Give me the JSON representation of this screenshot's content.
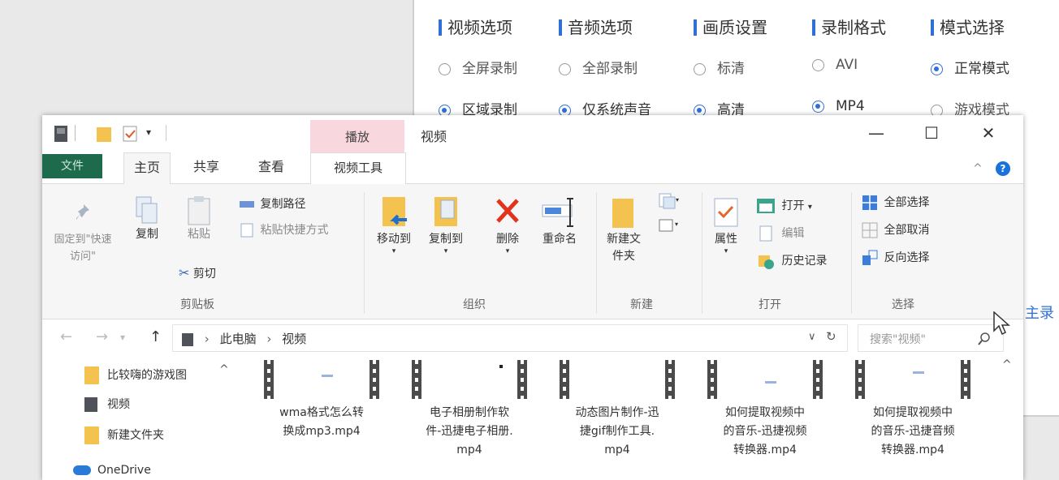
{
  "recorder": {
    "columns": [
      {
        "title": "视频选项",
        "options": [
          {
            "label": "全屏录制",
            "checked": false
          },
          {
            "label": "区域录制",
            "checked": true
          }
        ]
      },
      {
        "title": "音频选项",
        "options": [
          {
            "label": "全部录制",
            "checked": false
          },
          {
            "label": "仅系统声音",
            "checked": true
          }
        ]
      },
      {
        "title": "画质设置",
        "options": [
          {
            "label": "标清",
            "checked": false
          },
          {
            "label": "高清",
            "checked": true
          }
        ]
      },
      {
        "title": "录制格式",
        "options": [
          {
            "label": "AVI",
            "checked": false
          },
          {
            "label": "MP4",
            "checked": true
          }
        ]
      },
      {
        "title": "模式选择",
        "options": [
          {
            "label": "正常模式",
            "checked": true
          },
          {
            "label": "游戏模式",
            "checked": false
          }
        ]
      }
    ],
    "partial_link": "主录"
  },
  "explorer": {
    "context_tab": "播放",
    "title": "视频",
    "window_buttons": {
      "minimize": "—",
      "maximize": "☐",
      "close": "✕"
    },
    "tabs": {
      "file": "文件",
      "home": "主页",
      "share": "共享",
      "view": "查看",
      "video_tools": "视频工具"
    },
    "ribbon": {
      "clipboard": {
        "pin": "固定到\"快速访问\"",
        "copy": "复制",
        "paste": "粘贴",
        "copy_path": "复制路径",
        "paste_shortcut": "粘贴快捷方式",
        "cut": "剪切",
        "group": "剪贴板"
      },
      "organize": {
        "move_to": "移动到",
        "copy_to": "复制到",
        "delete": "删除",
        "rename": "重命名",
        "group": "组织"
      },
      "new": {
        "new_folder": "新建文件夹",
        "group": "新建"
      },
      "open": {
        "properties": "属性",
        "open": "打开",
        "edit": "编辑",
        "history": "历史记录",
        "group": "打开"
      },
      "select": {
        "select_all": "全部选择",
        "select_none": "全部取消",
        "invert": "反向选择",
        "group": "选择"
      }
    },
    "address": {
      "crumbs": [
        "此电脑",
        "视频"
      ],
      "search_placeholder": "搜索\"视频\""
    },
    "nav_items": [
      "比较嗨的游戏图",
      "视频",
      "新建文件夹",
      "OneDrive"
    ],
    "files": [
      {
        "line1": "wma格式怎么转",
        "line2": "换成mp3.mp4",
        "line3": ""
      },
      {
        "line1": "电子相册制作软",
        "line2": "件-迅捷电子相册.",
        "line3": "mp4"
      },
      {
        "line1": "动态图片制作-迅",
        "line2": "捷gif制作工具.",
        "line3": "mp4"
      },
      {
        "line1": "如何提取视频中",
        "line2": "的音乐-迅捷视频",
        "line3": "转换器.mp4"
      },
      {
        "line1": "如何提取视频中",
        "line2": "的音乐-迅捷音频",
        "line3": "转换器.mp4"
      }
    ],
    "colors": {
      "file_tab": "#1d6b4c",
      "context_tab": "#f8d7df",
      "accent": "#2f6fd6"
    }
  }
}
